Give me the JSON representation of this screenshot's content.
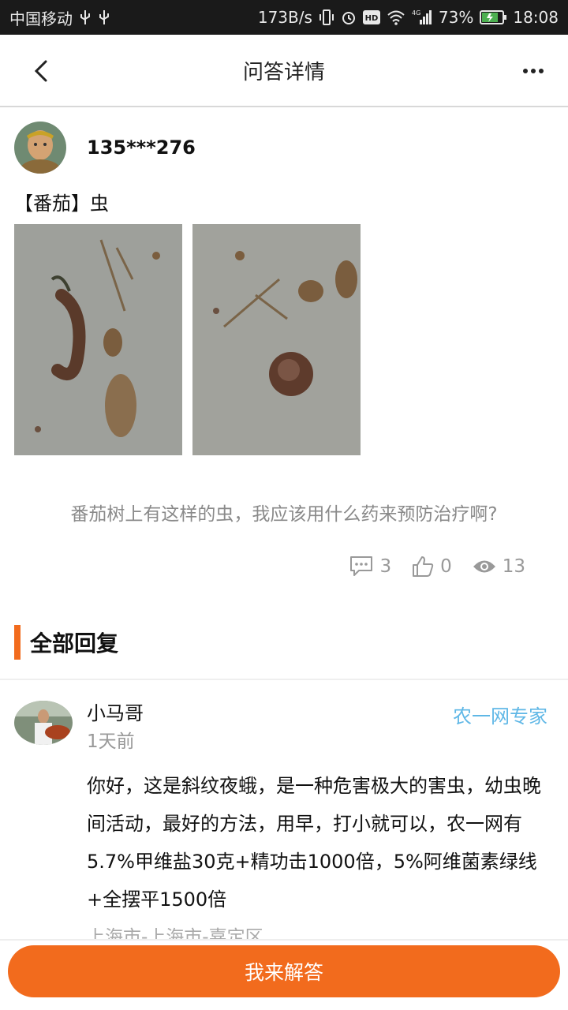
{
  "status_bar": {
    "carrier": "中国移动",
    "net_speed": "173B/s",
    "network": "4G",
    "battery": "73%",
    "time": "18:08"
  },
  "nav": {
    "title": "问答详情"
  },
  "question": {
    "username": "135***276",
    "title": "【番茄】虫",
    "images": [
      "caterpillar-photo-1",
      "caterpillar-photo-2"
    ],
    "text": "番茄树上有这样的虫，我应该用什么药来预防治疗啊?",
    "stats": {
      "comments": "3",
      "likes": "0",
      "views": "13"
    }
  },
  "section": {
    "title": "全部回复"
  },
  "reply": {
    "name": "小马哥",
    "time": "1天前",
    "badge": "农一网专家",
    "content": "你好，这是斜纹夜蛾，是一种危害极大的害虫，幼虫晚间活动，最好的方法，用早，打小就可以，农一网有5.7%甲维盐30克+精功击1000倍，5%阿维菌素绿线+全摆平1500倍",
    "location": "上海市-上海市-嘉定区"
  },
  "bottom": {
    "answer_label": "我来解答"
  },
  "colors": {
    "accent": "#f26b1d",
    "badge": "#5fb7e6"
  }
}
